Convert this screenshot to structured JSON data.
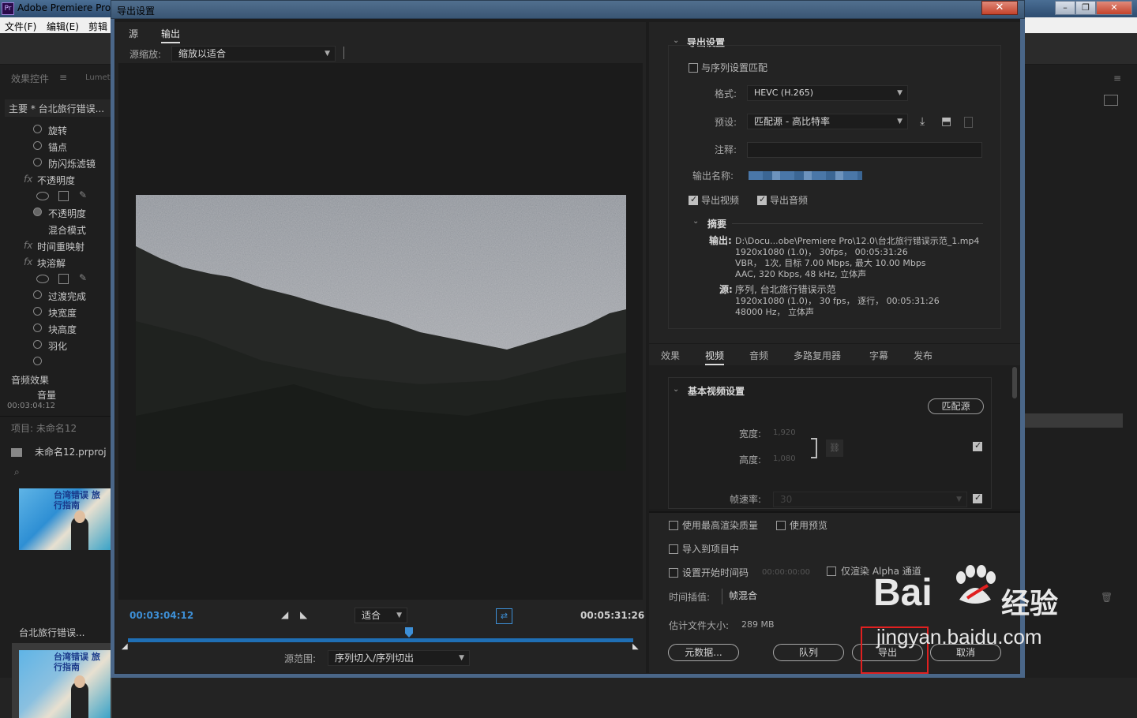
{
  "app": {
    "title": "Adobe Premiere Pro",
    "menu": [
      "文件(F)",
      "编辑(E)",
      "剪辑"
    ],
    "window_buttons": [
      "–",
      "❐",
      "✕"
    ]
  },
  "left_panel": {
    "tabs": [
      "效果控件",
      "Lumet"
    ],
    "clip_header": "主要 * 台北旅行错误...",
    "fx_rows": [
      "旋转",
      "锚点",
      "防闪烁滤镜",
      "不透明度",
      "不透明度",
      "混合模式",
      "时间重映射",
      "块溶解",
      "过渡完成",
      "块宽度",
      "块高度",
      "羽化"
    ],
    "audio_effects": "音频效果",
    "audio_row": "音量",
    "timecode": "00:03:04:12",
    "project_title": "项目: 未命名12",
    "project_file": "未命名12.prproj",
    "thumb1_text": "台湾错误 旅行指南",
    "thumb1_label": "台北旅行错误...",
    "thumb2_text": "台湾错误 旅行指南"
  },
  "dialog": {
    "title": "导出设置",
    "close": "✕",
    "source_tab": "源",
    "output_tab": "输出",
    "source_scale_label": "源缩放:",
    "source_scale_value": "缩放以适合",
    "current_time": "00:03:04:12",
    "fit_value": "适合",
    "duration": "00:05:31:26",
    "range_label": "源范围:",
    "range_value": "序列切入/序列切出"
  },
  "export_settings": {
    "section_title": "导出设置",
    "match_sequence": "与序列设置匹配",
    "format_label": "格式:",
    "format_value": "HEVC (H.265)",
    "preset_label": "预设:",
    "preset_value": "匹配源 - 高比特率",
    "comment_label": "注释:",
    "comment_value": "",
    "output_name_label": "输出名称:",
    "export_video": "导出视频",
    "export_audio": "导出音频",
    "summary_title": "摘要",
    "output_label": "输出:",
    "output_lines": [
      "D:\\Docu...obe\\Premiere Pro\\12.0\\台北旅行错误示范_1.mp4",
      "1920x1080 (1.0)， 30fps， 00:05:31:26",
      "VBR， 1次, 目标 7.00 Mbps, 最大 10.00 Mbps",
      "AAC, 320 Kbps, 48 kHz, 立体声"
    ],
    "source_label": "源:",
    "source_lines": [
      "序列, 台北旅行错误示范",
      "1920x1080 (1.0)， 30 fps， 逐行， 00:05:31:26",
      "48000 Hz， 立体声"
    ]
  },
  "tabs2": [
    "效果",
    "视频",
    "音频",
    "多路复用器",
    "字幕",
    "发布"
  ],
  "video": {
    "section_title": "基本视频设置",
    "match_source": "匹配源",
    "width_label": "宽度:",
    "width_value": "1,920",
    "height_label": "高度:",
    "height_value": "1,080",
    "fps_label": "帧速率:",
    "fps_value": "30"
  },
  "bottom": {
    "max_quality": "使用最高渲染质量",
    "use_previews": "使用预览",
    "import_project": "导入到项目中",
    "set_start_tc": "设置开始时间码",
    "start_tc_value": "00:00:00:00",
    "render_alpha": "仅渲染 Alpha 通道",
    "interp_label": "时间插值:",
    "interp_value": "帧混合",
    "filesize_label": "估计文件大小:",
    "filesize_value": "289 MB",
    "metadata_btn": "元数据...",
    "queue_btn": "队列",
    "export_btn": "导出",
    "cancel_btn": "取消"
  },
  "watermark": {
    "bai": "Bai",
    "jingyan": "经验",
    "url": "jingyan.baidu.com"
  }
}
